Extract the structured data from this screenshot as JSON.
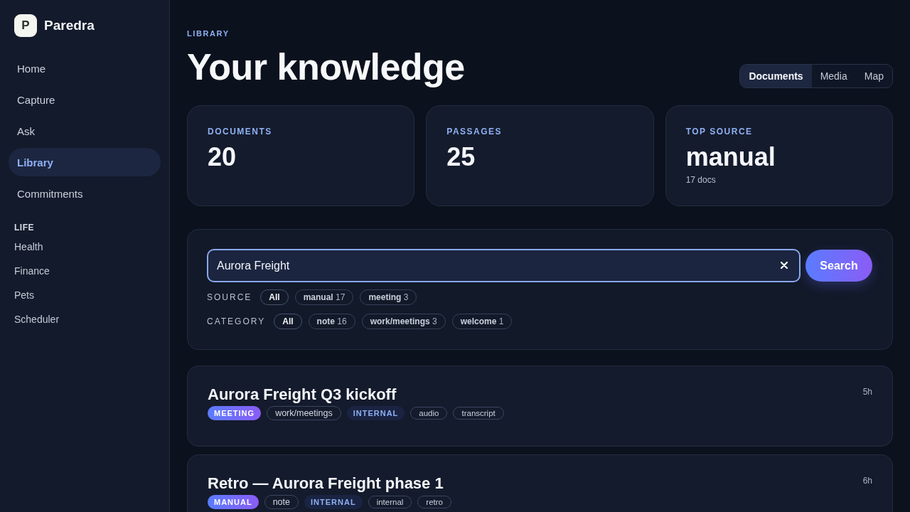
{
  "sidebar": {
    "brand": {
      "logo": "P",
      "name": "Paredra"
    },
    "nav": [
      {
        "label": "Home",
        "selected": false
      },
      {
        "label": "Capture",
        "selected": false
      },
      {
        "label": "Ask",
        "selected": false
      },
      {
        "label": "Library",
        "selected": true
      },
      {
        "label": "Commitments",
        "selected": false
      }
    ],
    "sections": [
      {
        "title": "LIFE",
        "items": [
          {
            "label": "Health"
          },
          {
            "label": "Finance"
          },
          {
            "label": "Pets"
          },
          {
            "label": "Scheduler"
          }
        ]
      }
    ]
  },
  "header": {
    "eyebrow": "LIBRARY",
    "title": "Your knowledge",
    "view_tabs": [
      {
        "label": "Documents",
        "selected": true
      },
      {
        "label": "Media",
        "selected": false
      },
      {
        "label": "Map",
        "selected": false
      }
    ]
  },
  "stats": [
    {
      "label": "DOCUMENTS",
      "value": "20"
    },
    {
      "label": "PASSAGES",
      "value": "25"
    },
    {
      "label": "TOP SOURCE",
      "value": "manual",
      "note": "17 docs"
    }
  ],
  "search": {
    "value": "Aurora Freight",
    "button": "Search",
    "filters": [
      {
        "label": "SOURCE",
        "chips": [
          {
            "label": "All",
            "selected": true
          },
          {
            "label": "manual",
            "count": "17",
            "selected": false
          },
          {
            "label": "meeting",
            "count": "3",
            "selected": false
          }
        ]
      },
      {
        "label": "CATEGORY",
        "chips": [
          {
            "label": "All",
            "selected": true
          },
          {
            "label": "note",
            "count": "16",
            "selected": false
          },
          {
            "label": "work/meetings",
            "count": "3",
            "selected": false
          },
          {
            "label": "welcome",
            "count": "1",
            "selected": false
          }
        ]
      }
    ]
  },
  "results": [
    {
      "title": "Aurora Freight Q3 kickoff",
      "time": "5h",
      "tags": [
        {
          "kind": "source",
          "label": "MEETING"
        },
        {
          "kind": "category",
          "label": "work/meetings"
        },
        {
          "kind": "visibility",
          "label": "INTERNAL"
        },
        {
          "kind": "tag",
          "label": "audio"
        },
        {
          "kind": "tag",
          "label": "transcript"
        }
      ]
    },
    {
      "title": "Retro — Aurora Freight phase 1",
      "time": "6h",
      "tags": [
        {
          "kind": "source",
          "label": "MANUAL"
        },
        {
          "kind": "category",
          "label": "note"
        },
        {
          "kind": "visibility",
          "label": "INTERNAL"
        },
        {
          "kind": "tag",
          "label": "internal"
        },
        {
          "kind": "tag",
          "label": "retro"
        }
      ]
    }
  ]
}
